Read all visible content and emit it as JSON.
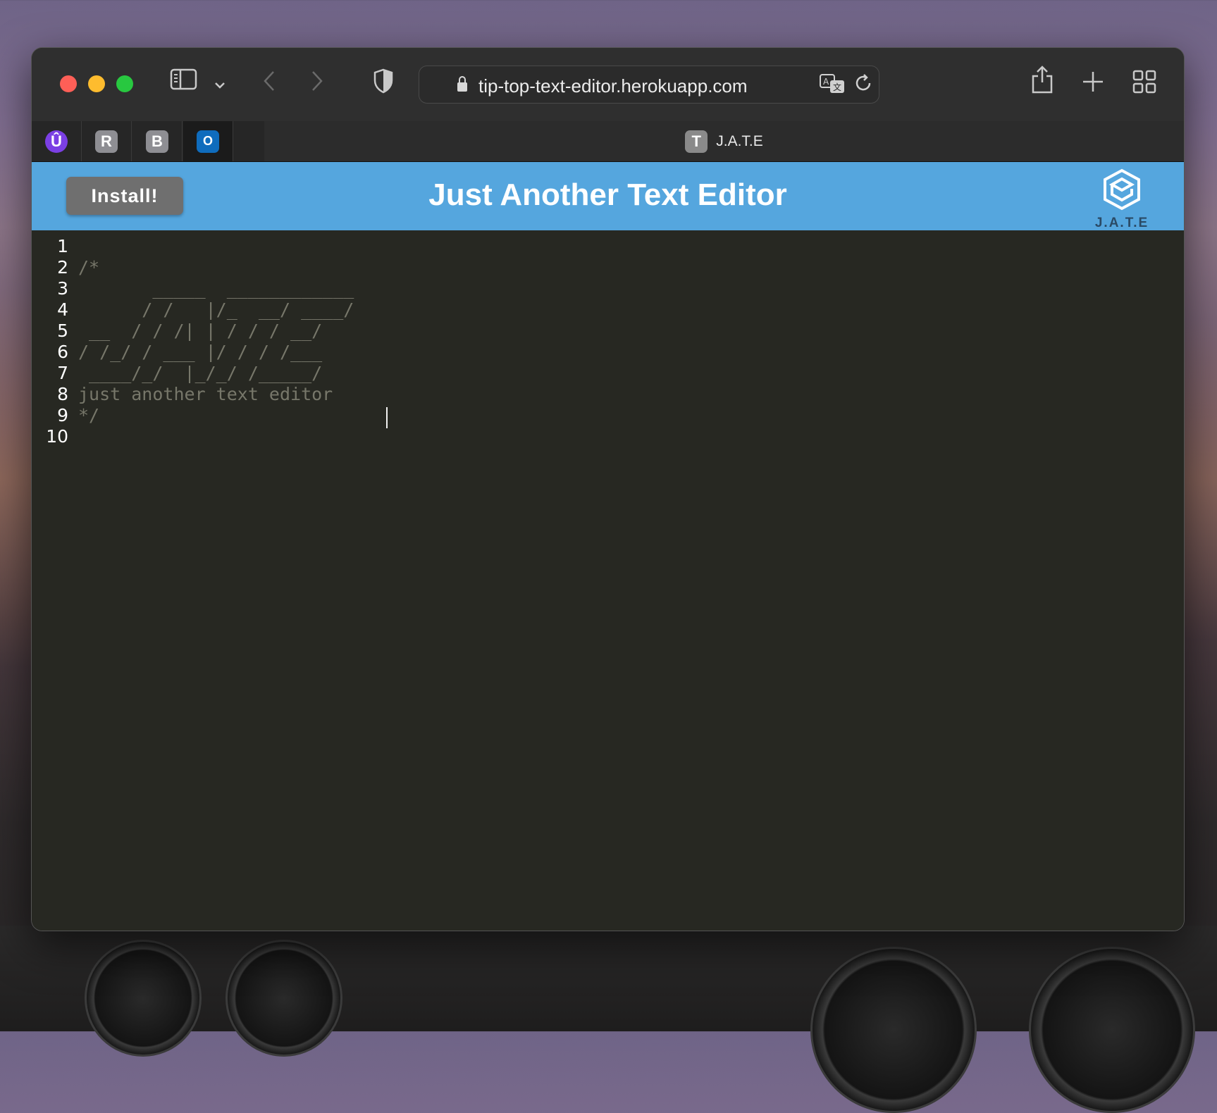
{
  "browser": {
    "url": "tip-top-text-editor.herokuapp.com",
    "pinned_tabs": [
      {
        "label": "Û",
        "color": "#7b3fe4"
      },
      {
        "label": "R",
        "color": "#8e8e93"
      },
      {
        "label": "B",
        "color": "#8e8e93"
      },
      {
        "label": "O",
        "color": "#0f6cbd"
      }
    ],
    "active_tab": {
      "favicon": "T",
      "title": "J.A.T.E"
    }
  },
  "app": {
    "install_label": "Install!",
    "title": "Just Another Text Editor",
    "logo_text": "J.A.T.E",
    "header_color": "#55a6de"
  },
  "editor": {
    "lines": [
      {
        "num": "1",
        "text": ""
      },
      {
        "num": "2",
        "text": "/*"
      },
      {
        "num": "3",
        "text": "       _____  ____________"
      },
      {
        "num": "4",
        "text": "      / /   |/_  __/ ____/"
      },
      {
        "num": "5",
        "text": " __  / / /| | / / / __/"
      },
      {
        "num": "6",
        "text": "/ /_/ / ___ |/ / / /___"
      },
      {
        "num": "7",
        "text": " ____/_/  |_/_/ /_____/"
      },
      {
        "num": "8",
        "text": "just another text editor"
      },
      {
        "num": "9",
        "text": "*/"
      },
      {
        "num": "10",
        "text": ""
      }
    ]
  }
}
